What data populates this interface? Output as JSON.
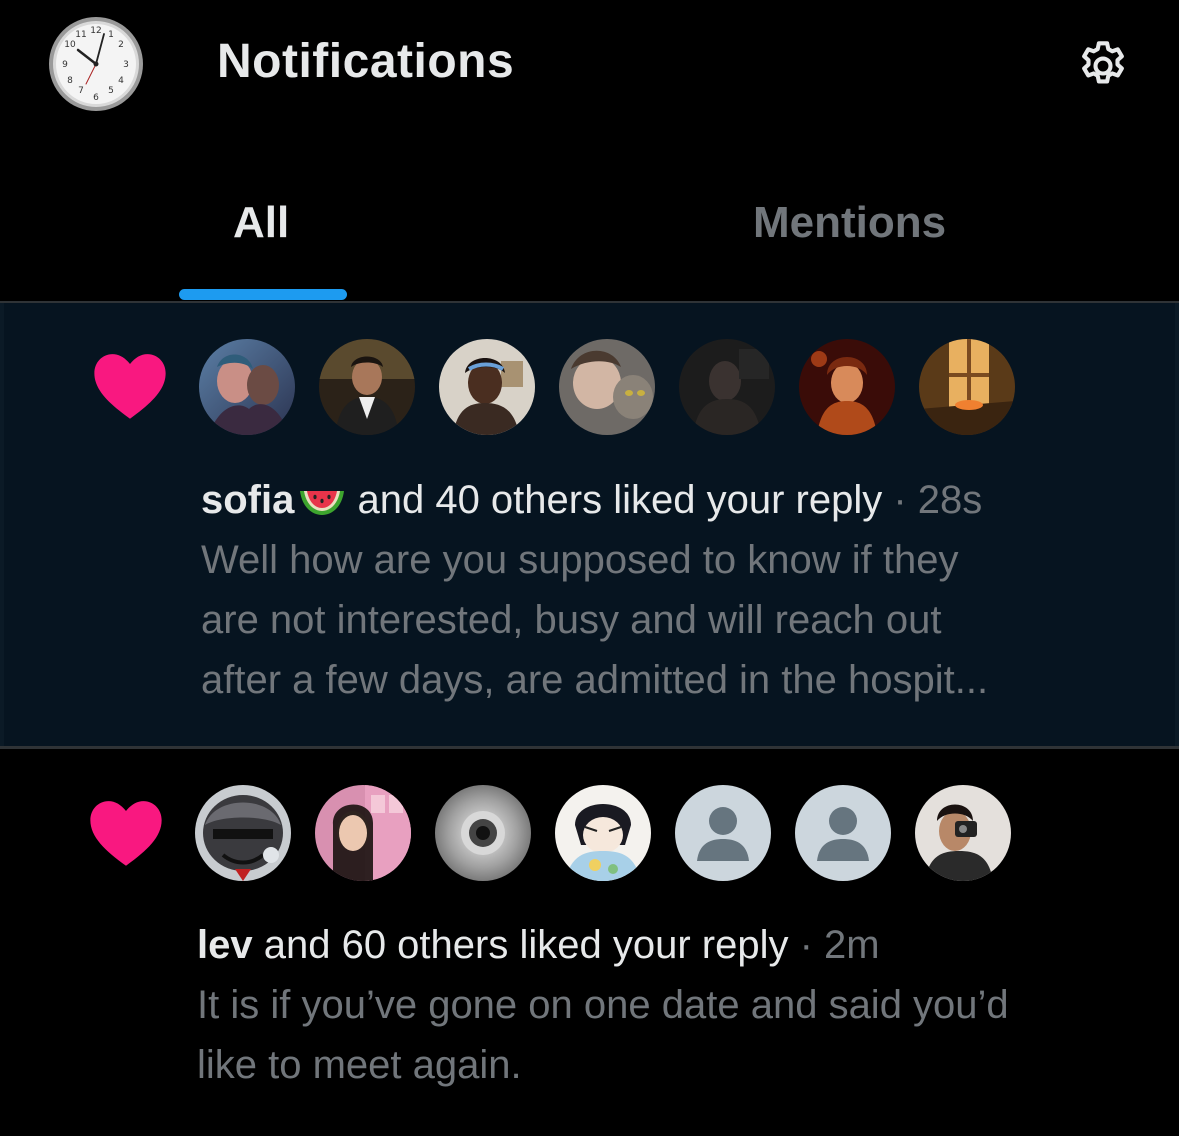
{
  "header": {
    "title": "Notifications",
    "settings_icon": "gear-icon",
    "profile_avatar": "clock-avatar"
  },
  "tabs": [
    {
      "label": "All",
      "active": true
    },
    {
      "label": "Mentions",
      "active": false
    }
  ],
  "colors": {
    "background": "#000000",
    "highlight_row": "#061420",
    "accent": "#1d9bf0",
    "heart": "#f91880",
    "primary_text": "#e7e9ea",
    "secondary_text": "#71767b",
    "divider": "#2f3336"
  },
  "notifications": [
    {
      "icon": "heart-icon",
      "user": "sofia",
      "user_emoji": "watermelon-icon",
      "action": " and 40 others liked your reply",
      "separator": " · ",
      "time": "28s",
      "preview_lines": [
        "Well how are you supposed to know if they",
        "are not interested, busy and will reach out",
        "after a few days, are admitted in the hospit..."
      ],
      "avatars": [
        "avatar-1",
        "avatar-2",
        "avatar-3",
        "avatar-4",
        "avatar-5",
        "avatar-6",
        "avatar-7"
      ],
      "unread": true
    },
    {
      "icon": "heart-icon",
      "user": "lev",
      "action": " and 60 others liked your reply",
      "separator": " · ",
      "time": "2m",
      "preview_lines": [
        "It is if you’ve gone on one date and said you’d",
        "like to meet again."
      ],
      "avatars": [
        "avatar-1",
        "avatar-2",
        "avatar-3",
        "avatar-4",
        "default-avatar",
        "default-avatar",
        "avatar-7"
      ],
      "unread": false
    }
  ]
}
